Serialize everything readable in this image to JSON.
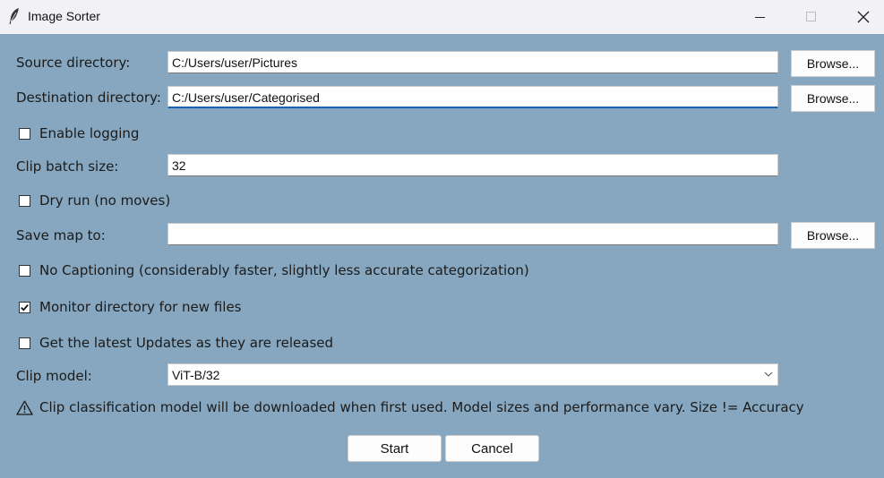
{
  "window": {
    "title": "Image Sorter",
    "app_icon": "feather-icon"
  },
  "form": {
    "source_label": "Source directory:",
    "source_value": "C:/Users/user/Pictures",
    "destination_label": "Destination directory:",
    "destination_value": "C:/Users/user/Categorised",
    "browse_label": "Browse...",
    "enable_logging_label": "Enable logging",
    "enable_logging_checked": false,
    "batch_label": "Clip batch size:",
    "batch_value": "32",
    "dry_run_label": "Dry run (no moves)",
    "dry_run_checked": false,
    "save_map_label": "Save map to:",
    "save_map_value": "",
    "no_caption_label": "No Captioning (considerably faster, slightly less accurate categorization)",
    "no_caption_checked": false,
    "monitor_label": "Monitor directory for new files",
    "monitor_checked": true,
    "updates_label": "Get the latest Updates as they are released",
    "updates_checked": false,
    "model_label": "Clip model:",
    "model_value": "ViT-B/32",
    "warning_text": "Clip classification model will be downloaded when first used. Model sizes and performance vary. Size != Accuracy",
    "start_label": "Start",
    "cancel_label": "Cancel"
  },
  "colors": {
    "background": "#86a7bf",
    "focus_accent": "#1a62b0"
  }
}
